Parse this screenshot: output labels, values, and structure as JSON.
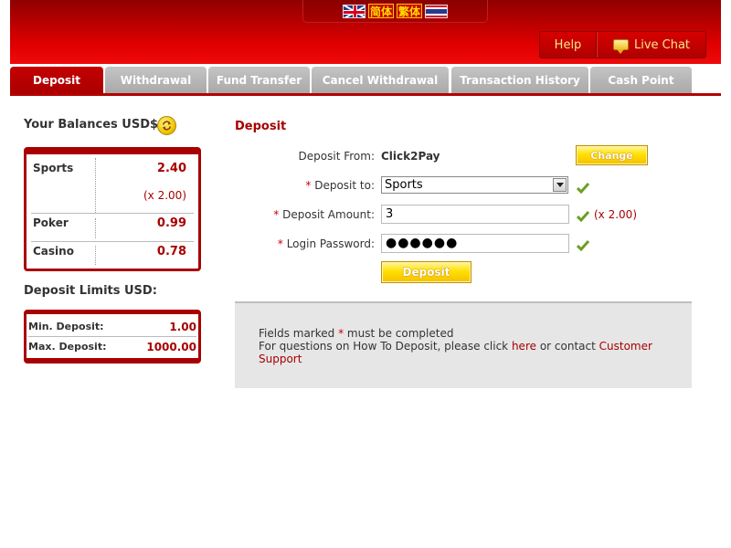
{
  "header": {
    "languages": [
      {
        "name": "English",
        "icon": "uk-flag-icon"
      },
      {
        "name": "简体",
        "label": "简体"
      },
      {
        "name": "繁体",
        "label": "繁体"
      },
      {
        "name": "Thai",
        "icon": "thai-flag-icon"
      }
    ],
    "help_label": "Help",
    "live_chat_label": "Live Chat"
  },
  "tabs": [
    {
      "label": "Deposit",
      "active": true
    },
    {
      "label": "Withdrawal",
      "active": false
    },
    {
      "label": "Fund Transfer",
      "active": false
    },
    {
      "label": "Cancel Withdrawal",
      "active": false
    },
    {
      "label": "Transaction History",
      "active": false
    },
    {
      "label": "Cash Point",
      "active": false
    }
  ],
  "balances": {
    "title": "Your Balances USD$",
    "rows": [
      {
        "name": "Sports",
        "value": "2.40",
        "multiplier": "(x 2.00)"
      },
      {
        "name": "Poker",
        "value": "0.99"
      },
      {
        "name": "Casino",
        "value": "0.78"
      }
    ]
  },
  "limits": {
    "title": "Deposit Limits USD:",
    "min_label": "Min. Deposit:",
    "min_value": "1.00",
    "max_label": "Max. Deposit:",
    "max_value": "1000.00"
  },
  "form": {
    "title": "Deposit",
    "deposit_from_label": "Deposit From:",
    "deposit_from_value": "Click2Pay",
    "change_label": "Change",
    "required_mark": "*",
    "deposit_to_label": " Deposit to:",
    "deposit_to_value": "Sports",
    "amount_label": " Deposit Amount:",
    "amount_value": "3",
    "amount_multiplier": "(x 2.00)",
    "password_label": " Login Password:",
    "password_masked": "●●●●●●",
    "submit_label": "Deposit"
  },
  "info": {
    "required_prefix": "Fields marked ",
    "required_mark": "*",
    "required_suffix": " must be completed",
    "questions_prefix": "For questions on How To Deposit, please click ",
    "here_link": "here",
    "contact_text": " or contact ",
    "support_link": "Customer Support"
  },
  "colors": {
    "brand_red": "#a80000",
    "tab_gray": "#b4b4b4",
    "button_yellow": "#ffe000",
    "check_green": "#6aa020"
  }
}
